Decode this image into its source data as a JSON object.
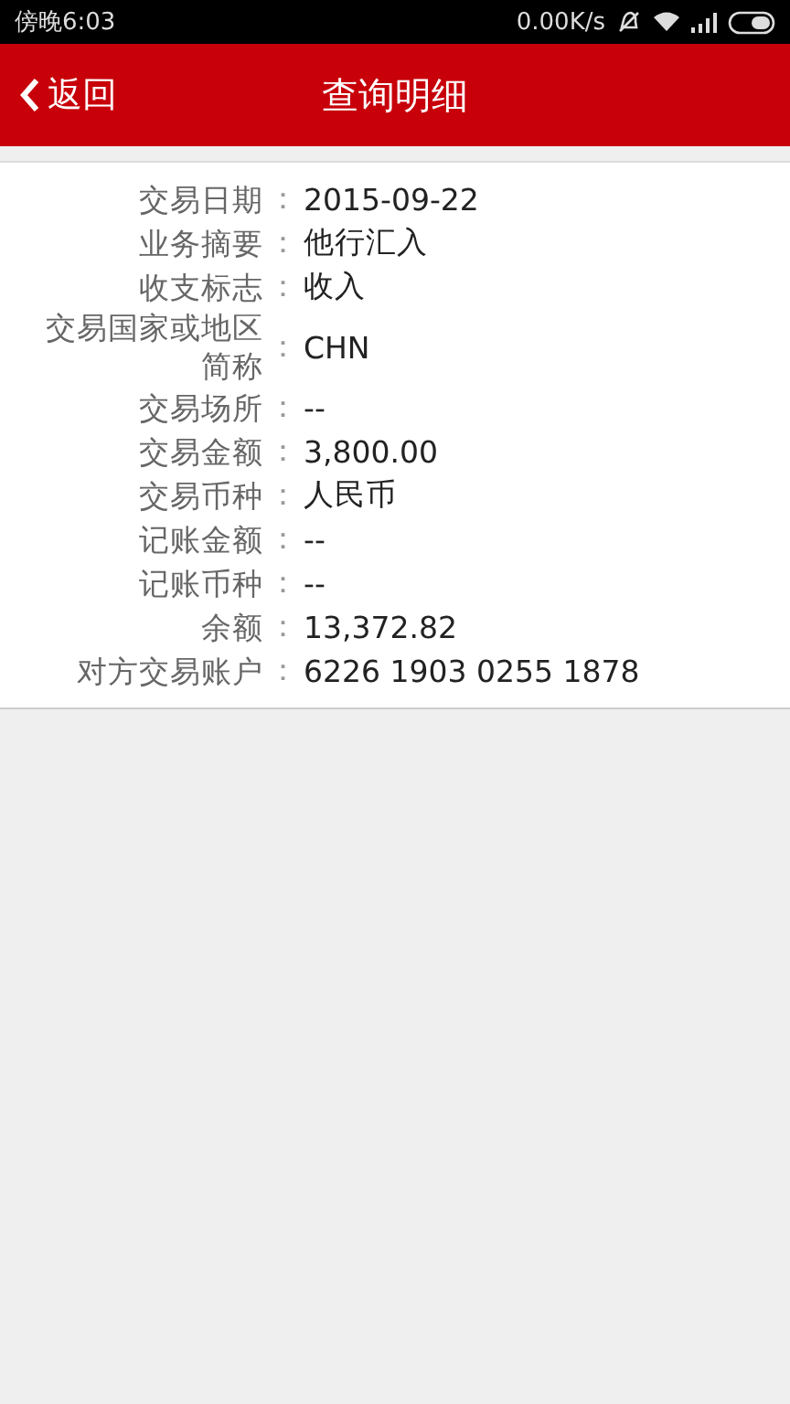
{
  "status_bar": {
    "time": "傍晚6:03",
    "speed": "0.00K/s"
  },
  "header": {
    "back": "返回",
    "title": "查询明细"
  },
  "details": [
    {
      "label": "交易日期",
      "value": "2015-09-22"
    },
    {
      "label": "业务摘要",
      "value": "他行汇入"
    },
    {
      "label": "收支标志",
      "value": "收入"
    },
    {
      "label": "交易国家或地区简称",
      "value": "CHN"
    },
    {
      "label": "交易场所",
      "value": "--"
    },
    {
      "label": "交易金额",
      "value": "3,800.00"
    },
    {
      "label": "交易币种",
      "value": "人民币"
    },
    {
      "label": "记账金额",
      "value": "--"
    },
    {
      "label": "记账币种",
      "value": "--"
    },
    {
      "label": "余额",
      "value": "13,372.82"
    },
    {
      "label": "对方交易账户",
      "value": "6226 1903 0255 1878"
    }
  ],
  "separator": "："
}
